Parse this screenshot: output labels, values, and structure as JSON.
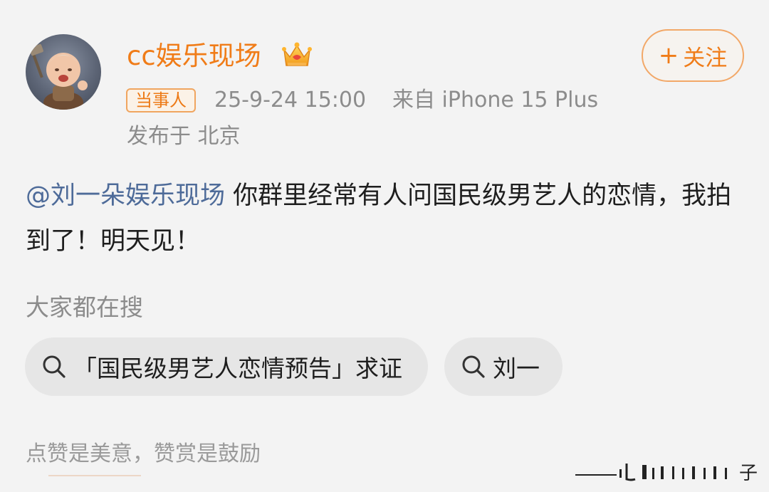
{
  "post": {
    "author": {
      "name": "cc娱乐现场",
      "badge_icon": "crown-badge-icon",
      "role_tag": "当事人"
    },
    "follow_label": "关注",
    "follow_icon": "plus-icon",
    "timestamp": "25-9-24 15:00",
    "source": "来自 iPhone 15 Plus",
    "location": "发布于 北京",
    "content": {
      "mention": "@刘一朵娱乐现场",
      "text": " 你群里经常有人问国民级男艺人的恋情，我拍到了！明天见！"
    }
  },
  "trending": {
    "title": "大家都在搜",
    "items": [
      {
        "label": "「国民级男艺人恋情预告」求证",
        "icon": "search-icon"
      },
      {
        "label": "刘一",
        "icon": "search-icon"
      }
    ]
  },
  "footer": {
    "reward_text": "点赞是美意，赞赏是鼓励",
    "watermark_partial": "子"
  },
  "colors": {
    "accent": "#f07c18",
    "mention": "#4e6b99",
    "meta": "#8c8c8c",
    "chip_bg": "#e6e6e6",
    "background": "#f3f3f3"
  }
}
